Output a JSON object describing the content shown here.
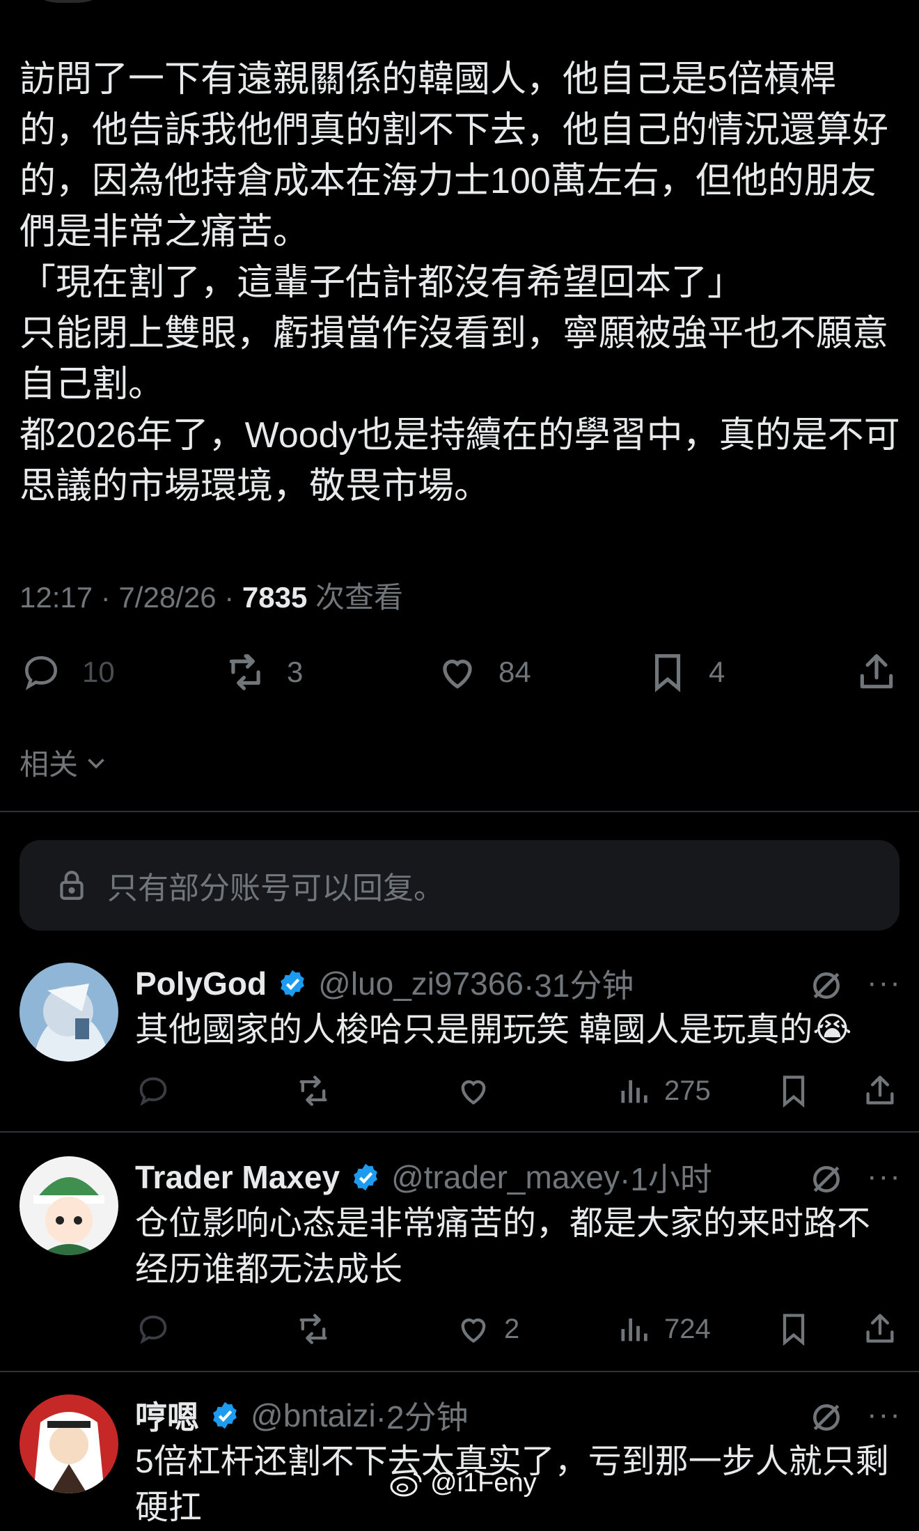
{
  "tweet": {
    "paragraphs": [
      "訪問了一下有遠親關係的韓國人，他自己是5倍槓桿的，他告訴我他們真的割不下去，他自己的情況還算好的，因為他持倉成本在海力士100萬左右，但他的朋友們是非常之痛苦。",
      "「現在割了，這輩子估計都沒有希望回本了」",
      "只能閉上雙眼，虧損當作沒看到，寧願被強平也不願意自己割。",
      "都2026年了，Woody也是持續在的學習中，真的是不可思議的市場環境，敬畏市場。"
    ],
    "time": "12:17 · 7/28/26 · ",
    "views": "7835",
    "views_label": " 次查看",
    "stats": {
      "replies": "10",
      "reposts": "3",
      "likes": "84",
      "bookmarks": "4"
    }
  },
  "related_label": "相关",
  "reply_notice": "只有部分账号可以回复。",
  "replies": [
    {
      "name": "PolyGod",
      "handle": "@luo_zi97366",
      "time": "·31分钟",
      "text": "其他國家的人梭哈只是開玩笑 韓國人是玩真的😭",
      "likes": "",
      "views": "275"
    },
    {
      "name": "Trader Maxey",
      "handle": "@trader_maxey",
      "time": "·1小时",
      "text": "仓位影响心态是非常痛苦的，都是大家的来时路不经历谁都无法成长",
      "likes": "2",
      "views": "724"
    },
    {
      "name": "哼嗯",
      "handle": "@bntaizi",
      "time": "·2分钟",
      "text": "5倍杠杆还割不下去太真实了，亏到那一步人就只剩硬扛"
    }
  ],
  "watermark": "@i1Feny",
  "colors": {
    "background": "#000000",
    "text": "#e7e9ea",
    "muted": "#71767b",
    "verified": "#1d9bf0"
  }
}
